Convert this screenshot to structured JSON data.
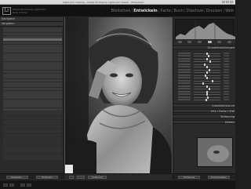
{
  "window": {
    "title": "Lightroom Catalog - Adobe Photoshop Lightroom Classic - Entwickeln"
  },
  "app": {
    "logo": "Lr",
    "identity_line1": "Adobe Photoshop Lightroom",
    "identity_line2": "Nele Zimmer"
  },
  "modules": [
    "Bibliothek",
    "Entwickeln",
    "Karte",
    "Buch",
    "Diashow",
    "Drucken",
    "Web"
  ],
  "active_module": "Entwickeln",
  "left_panel": {
    "navigator_label": "Navigator",
    "presets_label": "Vorgaben",
    "snapshots_label": "Schnappschüsse",
    "history_label": "Protokoll",
    "collections_label": "Sammlungen",
    "copy_button": "Kopieren...",
    "paste_button": "Einfügen"
  },
  "right_panel": {
    "basic_label": "Grundeinstellungen",
    "tone_curve_label": "Gradationskurve",
    "hsl_label": "HSL / Farbe / S/W",
    "split_toning_label": "Teiltonung",
    "detail_label": "Details",
    "previous_button": "Vorherige",
    "reset_button": "Zurücksetzen"
  },
  "toolbar": {
    "softproof_label": "Softproof"
  },
  "colors": {
    "accent": "#e0e0e0",
    "panel": "#2a2a2a",
    "header": "#111111"
  }
}
